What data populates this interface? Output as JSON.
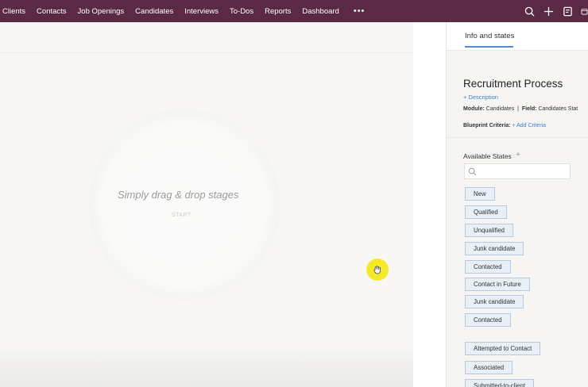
{
  "nav": {
    "items": [
      "Clients",
      "Contacts",
      "Job Openings",
      "Candidates",
      "Interviews",
      "To-Dos",
      "Reports",
      "Dashboard"
    ],
    "more": "•••"
  },
  "canvas": {
    "hint": "Simply drag & drop stages",
    "start": "START"
  },
  "panel": {
    "tab": "Info and states",
    "title": "Recruitment Process",
    "description_link": "+ Description",
    "module_label": "Module:",
    "module_value": "Candidates",
    "field_label": "Field:",
    "field_value": "Candidates Stat",
    "criteria_label": "Blueprint Criteria:",
    "criteria_link": "+ Add Criteria",
    "states_label": "Available States",
    "states_add": "+",
    "states_group1": [
      "New",
      "Qualified",
      "Unqualified",
      "Junk candidate",
      "Contacted",
      "Contact in Future",
      "Junk candidate",
      "Contacted"
    ],
    "states_group2": [
      "Attempted to Contact",
      "Associated",
      "Submitted-to-client"
    ]
  },
  "colors": {
    "nav_bg": "#5a2a45",
    "accent": "#4a90d9",
    "chip_bg": "#e8eff7",
    "cursor": "#f5ea2a"
  }
}
